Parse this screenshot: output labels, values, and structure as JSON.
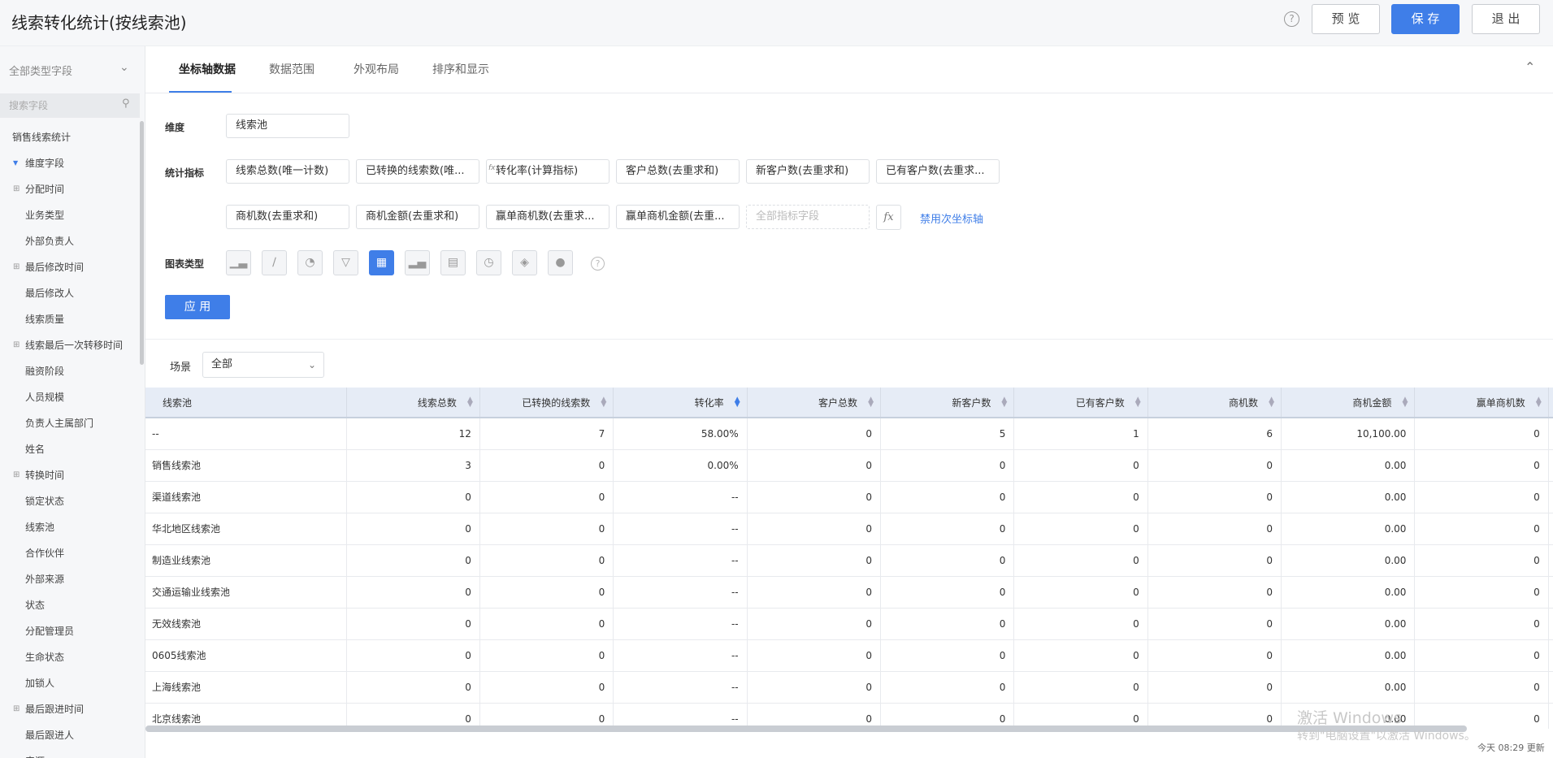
{
  "header": {
    "title": "线索转化统计(按线索池)",
    "help_glyph": "?",
    "preview_label": "预 览",
    "save_label": "保 存",
    "exit_label": "退 出"
  },
  "sidebar": {
    "field_type": "全部类型字段",
    "search_placeholder": "搜索字段",
    "root": "销售线索统计",
    "dimension_group": "维度字段",
    "items": [
      {
        "label": "分配时间",
        "type": "group"
      },
      {
        "label": "业务类型",
        "type": "leaf"
      },
      {
        "label": "外部负责人",
        "type": "leaf"
      },
      {
        "label": "最后修改时间",
        "type": "group"
      },
      {
        "label": "最后修改人",
        "type": "leaf"
      },
      {
        "label": "线索质量",
        "type": "leaf"
      },
      {
        "label": "线索最后一次转移时间",
        "type": "group"
      },
      {
        "label": "融资阶段",
        "type": "leaf"
      },
      {
        "label": "人员规模",
        "type": "leaf"
      },
      {
        "label": "负责人主属部门",
        "type": "leaf"
      },
      {
        "label": "姓名",
        "type": "leaf"
      },
      {
        "label": "转换时间",
        "type": "group"
      },
      {
        "label": "锁定状态",
        "type": "leaf"
      },
      {
        "label": "线索池",
        "type": "leaf"
      },
      {
        "label": "合作伙伴",
        "type": "leaf"
      },
      {
        "label": "外部来源",
        "type": "leaf"
      },
      {
        "label": "状态",
        "type": "leaf"
      },
      {
        "label": "分配管理员",
        "type": "leaf"
      },
      {
        "label": "生命状态",
        "type": "leaf"
      },
      {
        "label": "加锁人",
        "type": "leaf"
      },
      {
        "label": "最后跟进时间",
        "type": "group"
      },
      {
        "label": "最后跟进人",
        "type": "leaf"
      },
      {
        "label": "来源",
        "type": "leaf"
      }
    ]
  },
  "tabs": [
    "坐标轴数据",
    "数据范围",
    "外观布局",
    "排序和显示"
  ],
  "config": {
    "dimension_label": "维度",
    "dimension_value": "线索池",
    "metrics_label": "统计指标",
    "metrics_row1": [
      "线索总数(唯一计数)",
      "已转换的线索数(唯...",
      "转化率(计算指标)",
      "客户总数(去重求和)",
      "新客户数(去重求和)",
      "已有客户数(去重求..."
    ],
    "metrics_row2": [
      "商机数(去重求和)",
      "商机金额(去重求和)",
      "赢单商机数(去重求...",
      "赢单商机金额(去重..."
    ],
    "metric_placeholder": "全部指标字段",
    "fx_label": "fx",
    "disable_secondary_axis": "禁用次坐标轴",
    "chart_type_label": "图表类型",
    "chart_types": [
      "bar-chart-icon",
      "line-chart-icon",
      "pie-chart-icon",
      "funnel-chart-icon",
      "table-chart-icon",
      "combo-chart-icon",
      "card-chart-icon",
      "gauge-chart-icon",
      "map-chart-icon",
      "map-bubble-icon"
    ],
    "chart_type_selected": "table-chart-icon",
    "apply_label": "应 用",
    "accent_color": "#3f7ee8"
  },
  "scene": {
    "label": "场景",
    "value": "全部"
  },
  "table": {
    "columns": [
      "线索池",
      "线索总数",
      "已转换的线索数",
      "转化率",
      "客户总数",
      "新客户数",
      "已有客户数",
      "商机数",
      "商机金额",
      "赢单商机数"
    ],
    "sorted_column": "转化率",
    "rows": [
      [
        "--",
        "12",
        "7",
        "58.00%",
        "0",
        "5",
        "1",
        "6",
        "10,100.00",
        "0"
      ],
      [
        "销售线索池",
        "3",
        "0",
        "0.00%",
        "0",
        "0",
        "0",
        "0",
        "0.00",
        "0"
      ],
      [
        "渠道线索池",
        "0",
        "0",
        "--",
        "0",
        "0",
        "0",
        "0",
        "0.00",
        "0"
      ],
      [
        "华北地区线索池",
        "0",
        "0",
        "--",
        "0",
        "0",
        "0",
        "0",
        "0.00",
        "0"
      ],
      [
        "制造业线索池",
        "0",
        "0",
        "--",
        "0",
        "0",
        "0",
        "0",
        "0.00",
        "0"
      ],
      [
        "交通运输业线索池",
        "0",
        "0",
        "--",
        "0",
        "0",
        "0",
        "0",
        "0.00",
        "0"
      ],
      [
        "无效线索池",
        "0",
        "0",
        "--",
        "0",
        "0",
        "0",
        "0",
        "0.00",
        "0"
      ],
      [
        "0605线索池",
        "0",
        "0",
        "--",
        "0",
        "0",
        "0",
        "0",
        "0.00",
        "0"
      ],
      [
        "上海线索池",
        "0",
        "0",
        "--",
        "0",
        "0",
        "0",
        "0",
        "0.00",
        "0"
      ],
      [
        "北京线索池",
        "0",
        "0",
        "--",
        "0",
        "0",
        "0",
        "0",
        "0.00",
        "0"
      ]
    ]
  },
  "watermark": {
    "line1": "激活 Windows",
    "line2": "转到\"电脑设置\"以激活 Windows。"
  },
  "update_time": "今天 08:29 更新"
}
